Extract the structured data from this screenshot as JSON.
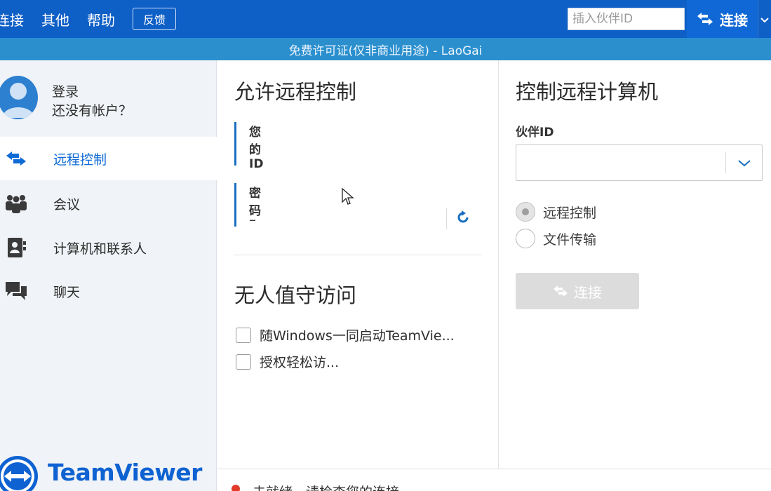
{
  "menu": {
    "items": [
      "连接",
      "其他",
      "帮助"
    ],
    "feedback_label": "反馈"
  },
  "top": {
    "partner_placeholder": "插入伙伴ID",
    "connect_label": "连接"
  },
  "license_text": "免费许可证(仅非商业用途) - LaoGai",
  "sidebar": {
    "login_label": "登录",
    "signup_label": "还没有帐户？",
    "items": [
      {
        "label": "远程控制",
        "icon": "remote-arrows-icon",
        "active": true
      },
      {
        "label": "会议",
        "icon": "meeting-people-icon",
        "active": false
      },
      {
        "label": "计算机和联系人",
        "icon": "contacts-book-icon",
        "active": false
      },
      {
        "label": "聊天",
        "icon": "chat-bubbles-icon",
        "active": false
      }
    ],
    "brand": "TeamViewer"
  },
  "allow": {
    "title": "允许远程控制",
    "id_label": "您的ID",
    "id_value": "–",
    "password_label": "密码",
    "password_value": "–"
  },
  "unattended": {
    "title": "无人值守访问",
    "options": [
      {
        "label": "随Windows一同启动TeamVie...",
        "checked": false
      },
      {
        "label": "授权轻松访...",
        "checked": false
      }
    ]
  },
  "control": {
    "title": "控制远程计算机",
    "partner_label": "伙伴ID",
    "partner_value": "",
    "modes": [
      {
        "label": "远程控制",
        "checked": true
      },
      {
        "label": "文件传输",
        "checked": false
      }
    ],
    "connect_label": "连接"
  },
  "status": {
    "text": "未就绪，请检查您的连接",
    "color": "#e23b2c"
  },
  "colors": {
    "brand_blue": "#0e5fc6",
    "license_blue": "#2b8fce",
    "accent": "#0e6ad5"
  }
}
